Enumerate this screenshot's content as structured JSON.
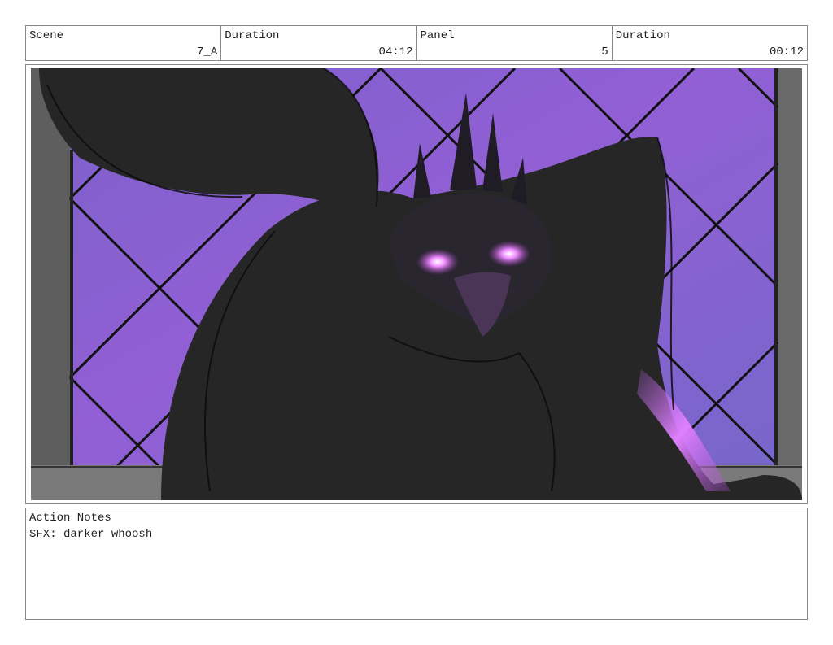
{
  "header": {
    "scene_label": "Scene",
    "scene_value": "7_A",
    "duration1_label": "Duration",
    "duration1_value": "04:12",
    "panel_label": "Panel",
    "panel_value": "5",
    "duration2_label": "Duration",
    "duration2_value": "00:12"
  },
  "notes": {
    "label": "Action Notes",
    "text": "SFX: darker whoosh"
  },
  "colors": {
    "border": "#888888",
    "window_purple": "#7a5bd0",
    "glow": "#e070ff",
    "silhouette": "#262626"
  }
}
